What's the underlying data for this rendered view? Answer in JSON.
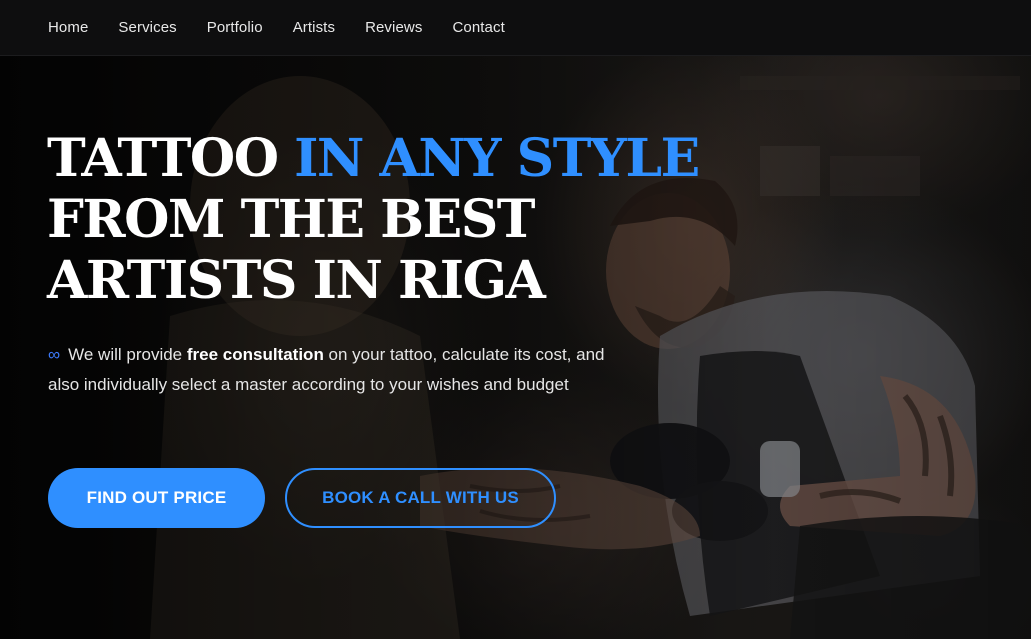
{
  "nav": {
    "items": [
      {
        "label": "Home"
      },
      {
        "label": "Services"
      },
      {
        "label": "Portfolio"
      },
      {
        "label": "Artists"
      },
      {
        "label": "Reviews"
      },
      {
        "label": "Contact"
      }
    ]
  },
  "hero": {
    "headline": {
      "part1": "TATTOO ",
      "accent": "IN ANY STYLE",
      "line2": "FROM THE BEST",
      "line3": "ARTISTS IN RIGA"
    },
    "description": {
      "icon": "infinity-icon",
      "prefix": "We will provide ",
      "bold": "free consultation",
      "suffix": " on your tattoo, calculate its cost, and also individually select a master according to your wishes and budget"
    },
    "buttons": {
      "primary": "FIND OUT PRICE",
      "secondary": "BOOK A CALL WITH US"
    }
  },
  "colors": {
    "accent": "#2f8fff",
    "nav_bg": "#0e0e0f",
    "text": "#ffffff"
  }
}
